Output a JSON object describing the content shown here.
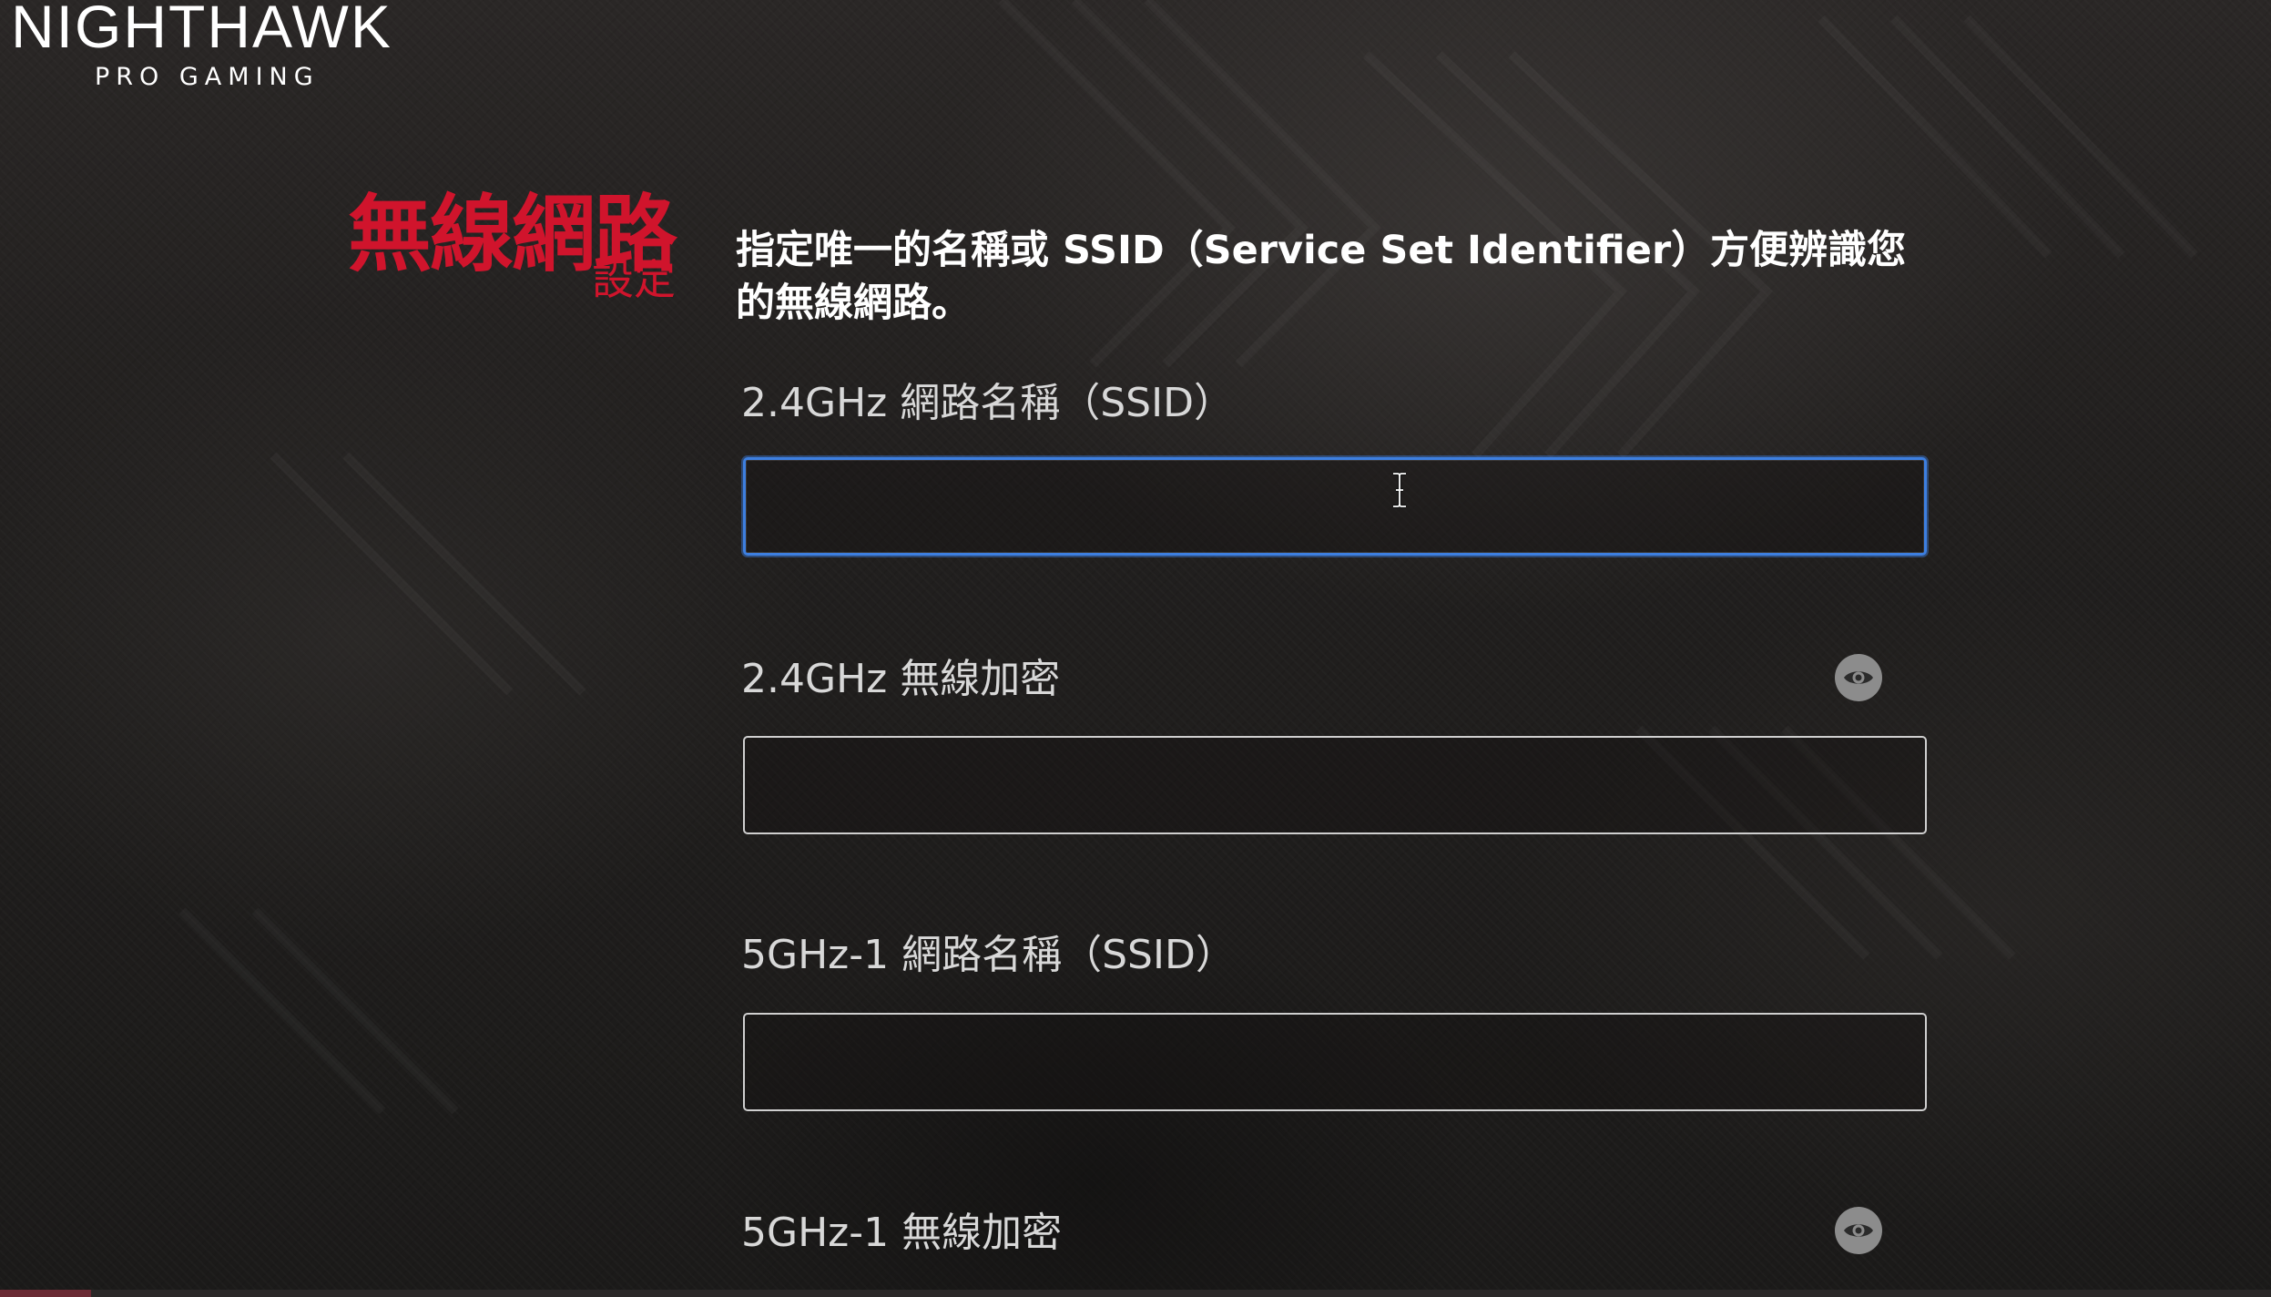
{
  "logo": {
    "main": "NIGHTHAWK",
    "sub": "PRO GAMING"
  },
  "heading": {
    "title": "無線網路",
    "subtitle": "設定"
  },
  "intro": {
    "line1": "指定唯一的名稱或 SSID（Service Set Identifier）方便辨識您",
    "line2": "的無線網路。"
  },
  "fields": [
    {
      "label": "2.4GHz 網路名稱（SSID）",
      "value": "",
      "focused": true
    },
    {
      "label": "2.4GHz 無線加密",
      "value": "",
      "has_eye_icon": true
    },
    {
      "label": "5GHz-1 網路名稱（SSID）",
      "value": ""
    },
    {
      "label": "5GHz-1 無線加密",
      "value": "",
      "has_eye_icon": true
    }
  ],
  "colors": {
    "accent_red": "#d0142c",
    "focus_blue": "#3d7fe0",
    "background": "#1f1d1c"
  }
}
